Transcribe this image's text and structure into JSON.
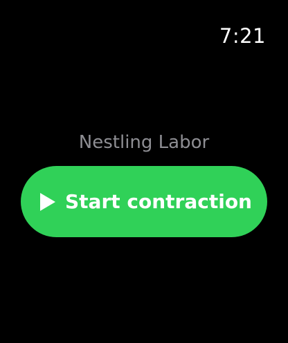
{
  "status_bar": {
    "time": "7:21"
  },
  "app": {
    "title": "Nestling Labor"
  },
  "start_button": {
    "label": "Start contraction",
    "icon": "play-icon",
    "color": "#30d158"
  },
  "colors": {
    "background": "#000000",
    "title_text": "#8e8e93",
    "button_text": "#ffffff"
  }
}
